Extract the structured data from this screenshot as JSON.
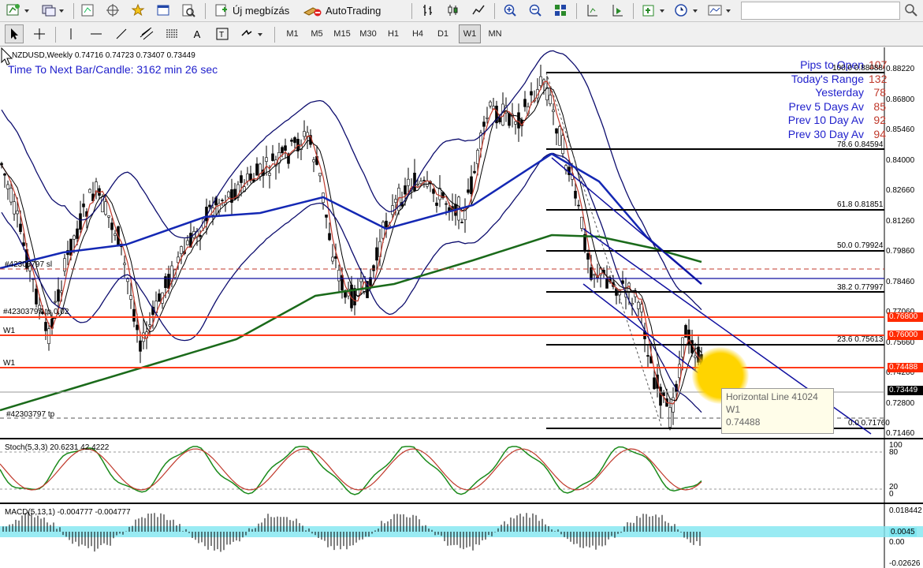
{
  "toolbar": {
    "new_order_label": "Új megbízás",
    "autotrading_label": "AutoTrading",
    "search_placeholder": ""
  },
  "timeframes": [
    "M1",
    "M5",
    "M15",
    "M30",
    "H1",
    "H4",
    "D1",
    "W1",
    "MN"
  ],
  "active_timeframe": "W1",
  "chart": {
    "title": "NZDUSD,Weekly  0.74716 0.74723 0.73407 0.73449",
    "timer": "Time To Next Bar/Candle: 3162 min 26 sec",
    "price_axis": [
      "0.88220",
      "0.86800",
      "0.85460",
      "0.84000",
      "0.82660",
      "0.81260",
      "0.79860",
      "0.78460",
      "0.77060",
      "0.75660",
      "0.74200",
      "0.72800",
      "0.71460"
    ],
    "price_tags": [
      {
        "text": "0.76800",
        "color": "#ff2a00"
      },
      {
        "text": "0.76000",
        "color": "#ff2a00"
      },
      {
        "text": "0.74488",
        "color": "#ff2a00"
      },
      {
        "text": "0.73449",
        "color": "#000000"
      }
    ],
    "fib_labels": [
      "100.0 0.88088",
      "78.6 0.84594",
      "61.8 0.81851",
      "50.0 0.79924",
      "38.2 0.77997",
      "23.6 0.75613",
      "0.0 0.71760"
    ],
    "left_labels": [
      "#42303797 sl",
      "#42303797 tp 0.02",
      "W1",
      "W1",
      "#42303797 tp"
    ],
    "pips_panel": [
      {
        "label": "Pips to Open",
        "value": "107"
      },
      {
        "label": "Today's Range",
        "value": "132"
      },
      {
        "label": "Yesterday",
        "value": "78"
      },
      {
        "label": "Prev 5 Days Av",
        "value": "85"
      },
      {
        "label": "Prev 10 Day Av",
        "value": "92"
      },
      {
        "label": "Prev 30 Day Av",
        "value": "94"
      }
    ],
    "tooltip": {
      "line1": "Horizontal Line 41024",
      "line2": "W1",
      "line3": "0.74488"
    }
  },
  "stoch": {
    "title": "Stoch(5,3,3) 20.6231 42.4222",
    "levels": [
      "100",
      "80",
      "20",
      "0"
    ]
  },
  "macd": {
    "title": "MACD(5,13,1) -0.004777 -0.004777",
    "axis": [
      "0.018442",
      "0.00",
      "-0.02626"
    ],
    "tags": [
      "0.0045",
      "0.00"
    ]
  },
  "colors": {
    "blue_line": "#1010a0",
    "red_line": "#ff3a1a",
    "ma_green": "#1a6a1a",
    "ma_blue": "#1428b4",
    "band": "#0d0d6e"
  }
}
